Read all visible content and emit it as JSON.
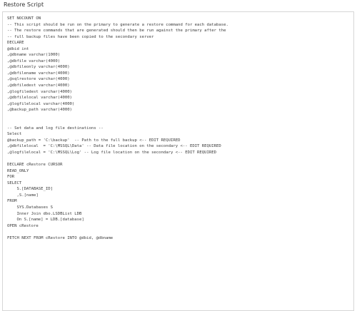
{
  "title": "Restore Script",
  "code_lines": [
    "SET NOCOUNT ON",
    "-- This script should be run on the primary to generate a restore command for each database.",
    "-- The restore commands that are generated should then be run against the primary after the",
    "-- full backup files have been copied to the secondary server",
    "DECLARE",
    "@dbid int",
    ",@dbname varchar(1000)",
    ",@dbfile varchar(4000)",
    ",@dbfileonly varchar(4000)",
    ",@dbfilename varchar(4000)",
    ",@sqlrestore varchar(4000)",
    ",@dbfiledest varchar(4000)",
    ",@logfiledest varchar(4000)",
    ",@dbfilelocal varchar(4000)",
    ",@logfilelocal varchar(4000)",
    ",@backup_path varchar(4000)",
    "",
    "",
    "-- Set data and log file destinations --",
    "Select",
    "@backup_path = 'C:\\backup'  -- Path to the full backup <-- EDIT REQUIRED",
    ",@dbfilelocal  = 'C:\\MSSQL\\Data' -- Data file location on the secondary <-- EDIT REQUIRED",
    ",@logfilelocal = 'C:\\MSSQL\\Log' -- Log file location on the secondary <-- EDIT REQUIRED",
    "",
    "DECLARE cRestore CURSOR",
    "READ_ONLY",
    "FOR",
    "SELECT",
    "    S.[DATABASE_ID]",
    "    ,S.[name]",
    "FROM",
    "    SYS.Databases S",
    "    Inner Join dbo.LSDBList LDB",
    "    On S.[name] = LDB.[database]",
    "OPEN cRestore",
    "",
    "FETCH NEXT FROM cRestore INTO @dbid, @dbname"
  ]
}
